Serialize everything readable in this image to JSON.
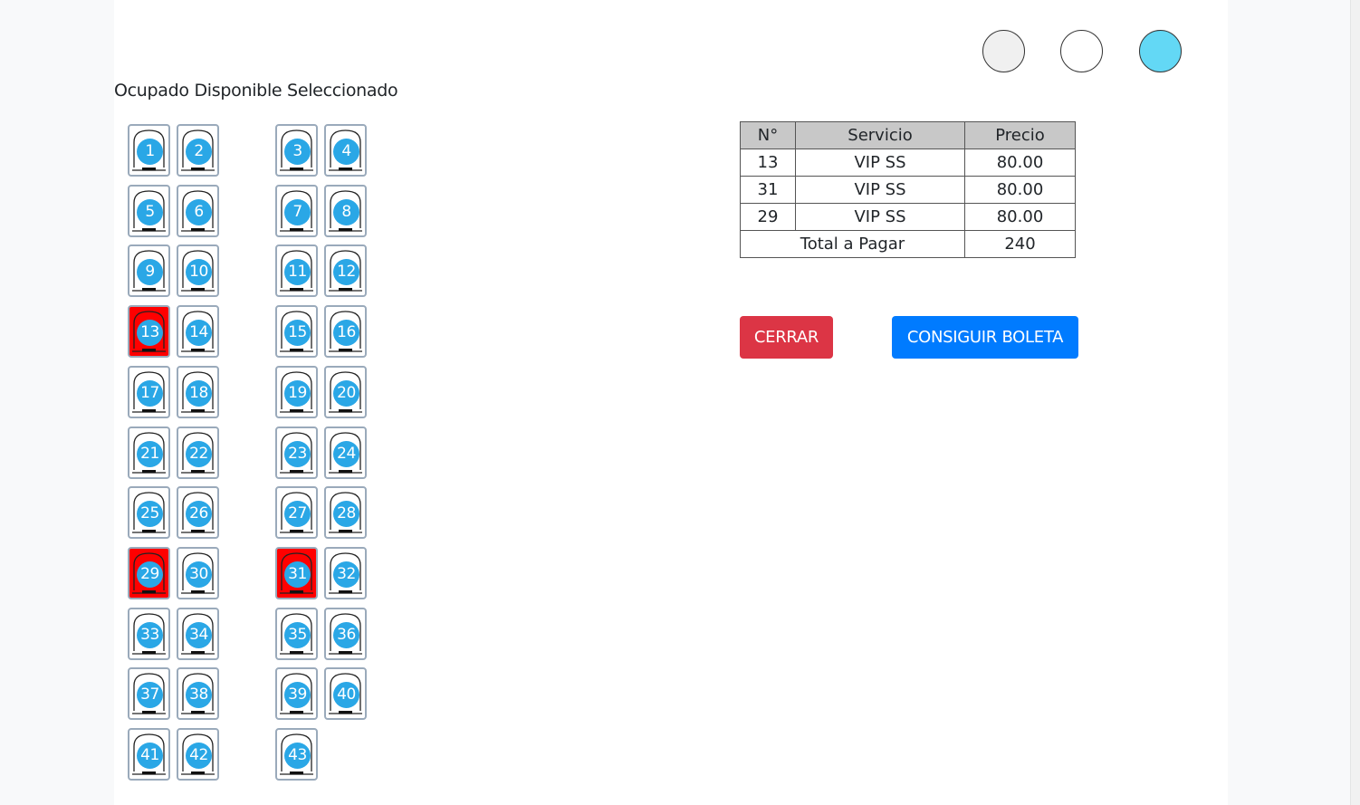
{
  "legend": {
    "text": "Ocupado Disponible Seleccionado",
    "colors": {
      "ocupado": "#f0f0f0",
      "disponible": "#ffffff",
      "seleccionado": "#63d8f5"
    }
  },
  "seats": [
    {
      "n": "1",
      "occupied": false
    },
    {
      "n": "2",
      "occupied": false
    },
    {
      "n": "3",
      "occupied": false
    },
    {
      "n": "4",
      "occupied": false
    },
    {
      "n": "5",
      "occupied": false
    },
    {
      "n": "6",
      "occupied": false
    },
    {
      "n": "7",
      "occupied": false
    },
    {
      "n": "8",
      "occupied": false
    },
    {
      "n": "9",
      "occupied": false
    },
    {
      "n": "10",
      "occupied": false
    },
    {
      "n": "11",
      "occupied": false
    },
    {
      "n": "12",
      "occupied": false
    },
    {
      "n": "13",
      "occupied": true
    },
    {
      "n": "14",
      "occupied": false
    },
    {
      "n": "15",
      "occupied": false
    },
    {
      "n": "16",
      "occupied": false
    },
    {
      "n": "17",
      "occupied": false
    },
    {
      "n": "18",
      "occupied": false
    },
    {
      "n": "19",
      "occupied": false
    },
    {
      "n": "20",
      "occupied": false
    },
    {
      "n": "21",
      "occupied": false
    },
    {
      "n": "22",
      "occupied": false
    },
    {
      "n": "23",
      "occupied": false
    },
    {
      "n": "24",
      "occupied": false
    },
    {
      "n": "25",
      "occupied": false
    },
    {
      "n": "26",
      "occupied": false
    },
    {
      "n": "27",
      "occupied": false
    },
    {
      "n": "28",
      "occupied": false
    },
    {
      "n": "29",
      "occupied": true
    },
    {
      "n": "30",
      "occupied": false
    },
    {
      "n": "31",
      "occupied": true
    },
    {
      "n": "32",
      "occupied": false
    },
    {
      "n": "33",
      "occupied": false
    },
    {
      "n": "34",
      "occupied": false
    },
    {
      "n": "35",
      "occupied": false
    },
    {
      "n": "36",
      "occupied": false
    },
    {
      "n": "37",
      "occupied": false
    },
    {
      "n": "38",
      "occupied": false
    },
    {
      "n": "39",
      "occupied": false
    },
    {
      "n": "40",
      "occupied": false
    },
    {
      "n": "41",
      "occupied": false
    },
    {
      "n": "42",
      "occupied": false
    },
    {
      "n": "43",
      "occupied": false
    }
  ],
  "seat_colors": {
    "occupied": "#ff0000",
    "badge": "#2aa7e6"
  },
  "table": {
    "headers": [
      "N°",
      "Servicio",
      "Precio"
    ],
    "rows": [
      [
        "13",
        "VIP SS",
        "80.00"
      ],
      [
        "31",
        "VIP SS",
        "80.00"
      ],
      [
        "29",
        "VIP SS",
        "80.00"
      ]
    ],
    "total_label": "Total a Pagar",
    "total_value": "240"
  },
  "buttons": {
    "close": "CERRAR",
    "get_receipt": "CONSIGUIR BOLETA"
  }
}
